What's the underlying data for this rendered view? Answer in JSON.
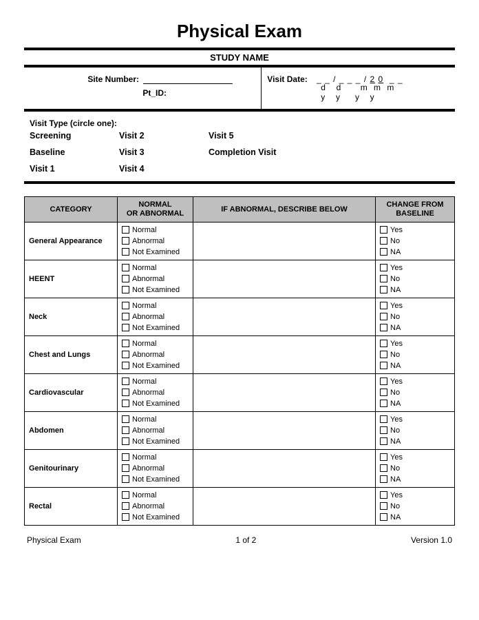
{
  "title": "Physical Exam",
  "study_name": "STUDY NAME",
  "header": {
    "site_number_label": "Site Number:",
    "pt_id_label": "Pt_ID:",
    "visit_date_label": "Visit Date:",
    "date_slots": "_ _ / _ _ _ / 2 0  _ _",
    "date_hint_d": "d",
    "date_hint_m": "m",
    "date_hint_y": "y"
  },
  "visit_type": {
    "label": "Visit Type (circle one):",
    "col1": {
      "a": "Screening",
      "b": "Baseline",
      "c": "Visit 1"
    },
    "col2": {
      "a": "Visit 2",
      "b": "Visit 3",
      "c": "Visit 4"
    },
    "col3": {
      "a": "Visit 5",
      "b": "Completion Visit"
    }
  },
  "table": {
    "headers": {
      "category": "CATEGORY",
      "normal": "NORMAL\nOR ABNORMAL",
      "describe": "IF ABNORMAL, DESCRIBE BELOW",
      "change": "CHANGE FROM\nBASELINE"
    },
    "norm_opts": {
      "a": "Normal",
      "b": "Abnormal",
      "c": "Not Examined"
    },
    "base_opts": {
      "a": "Yes",
      "b": "No",
      "c": "NA"
    },
    "categories": {
      "r0": "General Appearance",
      "r1": "HEENT",
      "r2": "Neck",
      "r3": "Chest and Lungs",
      "r4": "Cardiovascular",
      "r5": "Abdomen",
      "r6": "Genitourinary",
      "r7": "Rectal"
    }
  },
  "footer": {
    "left": "Physical Exam",
    "center": "1 of  2",
    "right": "Version 1.0"
  }
}
